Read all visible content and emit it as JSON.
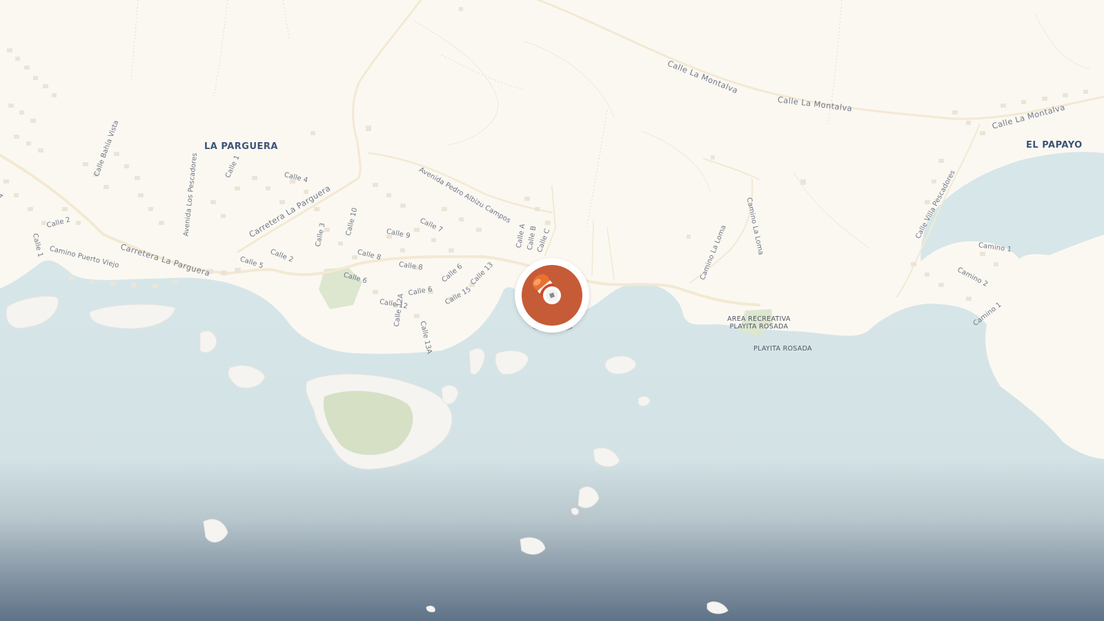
{
  "colors": {
    "land": "#fbf8f2",
    "water_top": "#d7e6e8",
    "water_bottom": "#607389",
    "road": "#f6ecd6",
    "building": "#ece6da",
    "park": "#dfe7cf",
    "marker": "#c65b37"
  },
  "places": {
    "la_parguera": "LA PARGUERA",
    "el_papayo": "EL PAPAYO"
  },
  "poi": {
    "area_recreativa_line1": "AREA RECREATIVA",
    "area_recreativa_line2": "PLAYITA ROSADA",
    "playita_rosada": "PLAYITA ROSADA"
  },
  "roads": {
    "calle_la_montalva_1": "Calle La Montalva",
    "calle_la_montalva_2": "Calle La Montalva",
    "calle_la_montalva_3": "Calle La Montalva",
    "avenida_pedro_albizu_campos": "Avenida Pedro Albizu Campos",
    "carretera_la_parguera_1": "Carretera La Parguera",
    "carretera_la_parguera_2": "Carretera La Parguera",
    "camino_puerto_viejo": "Camino Puerto Viejo",
    "calle_bahia_vista": "Calle Bahía Vista",
    "avenida_los_pescadores": "Avenida Los Pescadores",
    "calle_1": "Calle 1",
    "calle_1b": "Calle 1",
    "calle_2": "Calle 2",
    "calle_2b": "Calle 2",
    "calle_3": "Calle 3",
    "calle_4": "Calle 4",
    "calle_4b": "4",
    "calle_5": "Calle 5",
    "calle_6": "Calle 6",
    "calle_6b": "Calle 6",
    "calle_6c": "Calle 6",
    "calle_7": "Calle 7",
    "calle_8": "Calle 8",
    "calle_8b": "Calle 8",
    "calle_9": "Calle 9",
    "calle_10": "Calle 10",
    "calle_12": "Calle 12",
    "calle_12a": "Calle 12A",
    "calle_13": "Calle 13",
    "calle_13a": "Calle 13A",
    "calle_15": "Calle 15",
    "calle_a": "Calle A",
    "calle_b": "Calle B",
    "calle_c": "Calle C",
    "camino_la_loma_1": "Camino La Loma",
    "camino_la_loma_2": "Camino La Loma",
    "calle_villa_pescadores": "Calle Villa Pescadores",
    "camino_1": "Camino 1",
    "camino_1b": "Camino 1",
    "camino_2": "Camino 2"
  },
  "marker": {
    "icon": "bobber-pin-icon"
  }
}
